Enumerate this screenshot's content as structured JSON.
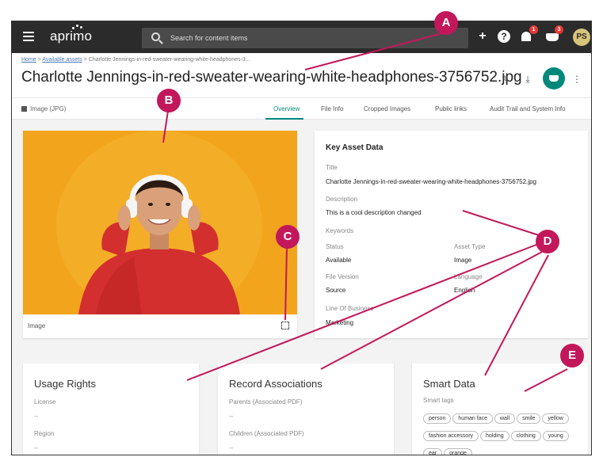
{
  "app": {
    "logo": "aprimo",
    "search_placeholder": "Search for content items",
    "notif_count": "1",
    "basket_count": "3",
    "user_initials": "PS"
  },
  "breadcrumb": {
    "home": "Home",
    "available": "Available assets",
    "current": "Charlotte Jennings-in-red-sweater-wearing-white-headphones-3..."
  },
  "asset": {
    "title": "Charlotte Jennings-in-red-sweater-wearing-white-headphones-3756752.jpg",
    "type_label": "Image (JPG)",
    "image_caption": "Image"
  },
  "tabs": [
    {
      "label": "Overview",
      "active": true
    },
    {
      "label": "File Info"
    },
    {
      "label": "Cropped Images"
    },
    {
      "label": "Public links"
    },
    {
      "label": "Audit Trail and System Info"
    }
  ],
  "key_data": {
    "heading": "Key Asset Data",
    "title_label": "Title",
    "title_value": "Charlotte Jennings-in-red-sweater-wearing-white-headphones-3756752.jpg",
    "description_label": "Description",
    "description_value": "This is a cool description changed",
    "keywords_label": "Keywords",
    "status_label": "Status",
    "status_value": "Available",
    "asset_type_label": "Asset Type",
    "asset_type_value": "Image",
    "file_version_label": "File Version",
    "file_version_value": "Source",
    "language_label": "Language",
    "language_value": "English",
    "lob_label": "Line Of Business",
    "lob_value": "Marketing"
  },
  "usage_rights": {
    "title": "Usage Rights",
    "license_label": "License",
    "license_value": "--",
    "region_label": "Region",
    "region_value": "--"
  },
  "record_associations": {
    "title": "Record Associations",
    "parents_label": "Parents (Associated PDF)",
    "parents_value": "--",
    "children_label": "Children (Associated PDF)",
    "children_value": "--"
  },
  "smart_data": {
    "title": "Smart Data",
    "tags_label": "Smart tags",
    "tags": [
      "person",
      "human face",
      "wall",
      "smile",
      "yellow",
      "fashion accessory",
      "holding",
      "clothing",
      "young",
      "ear",
      "orange"
    ]
  },
  "annotations": {
    "markers": [
      "A",
      "B",
      "C",
      "D",
      "E"
    ],
    "color": "#c2185b"
  }
}
